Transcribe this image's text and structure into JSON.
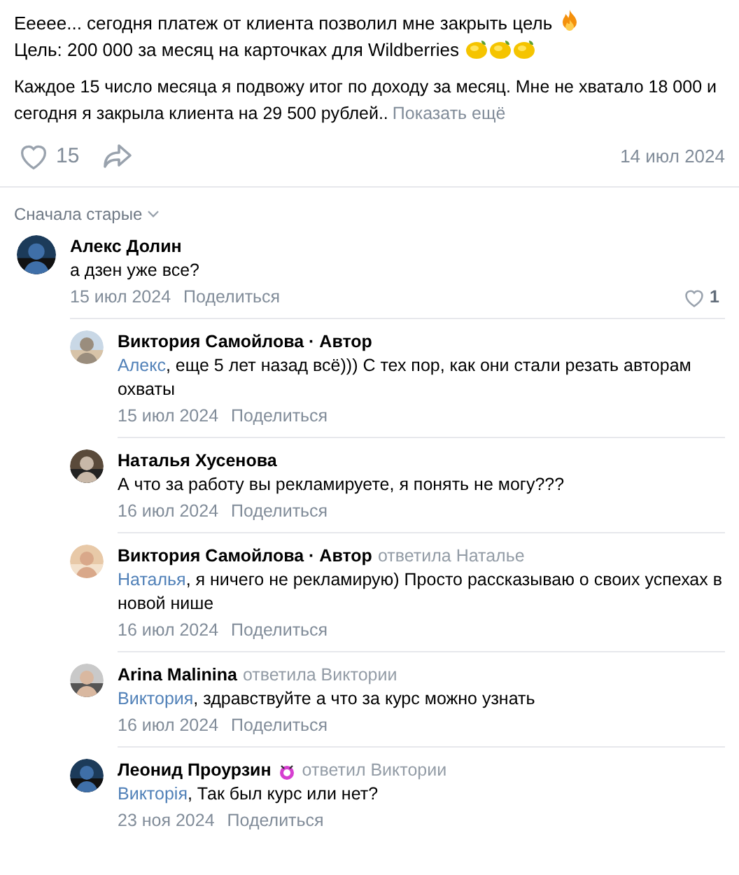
{
  "post": {
    "lines": [
      "Еееее... сегодня платеж от клиента позволил мне закрыть цель",
      "Цель: 200 000 за месяц на карточках для Wildberries"
    ],
    "body": "Каждое 15 число месяца я подвожу итог по доходу за месяц. Мне не хватало 18 000 и сегодня я закрыла клиента на 29 500 рублей..",
    "more": "Показать ещё",
    "likes": "15",
    "date": "14 июл 2024"
  },
  "sort": "Сначала старые",
  "comments": [
    {
      "name": "Алекс Долин",
      "text": "а дзен уже все?",
      "date": "15 июл 2024",
      "share": "Поделиться",
      "likes": "1",
      "replies": [
        {
          "name": "Виктория Самойлова · Автор",
          "mention": "Алекс",
          "text": ", еще 5 лет назад всё))) С тех пор, как они стали резать авторам охваты",
          "date": "15 июл 2024",
          "share": "Поделиться"
        },
        {
          "name": "Наталья Хусенова",
          "text": "А что за работу вы рекламируете, я понять не могу???",
          "date": "16 июл 2024",
          "share": "Поделиться"
        },
        {
          "name": "Виктория Самойлова · Автор",
          "reply_to": "ответила Наталье",
          "mention": "Наталья",
          "text": ", я ничего не рекламирую) Просто рассказываю о своих успехах в новой нише",
          "date": "16 июл 2024",
          "share": "Поделиться"
        },
        {
          "name": "Arina Malinina",
          "reply_to": "ответила Виктории",
          "mention": "Виктория",
          "text": ", здравствуйте а что за курс можно узнать",
          "date": "16 июл 2024",
          "share": "Поделиться"
        },
        {
          "name": "Леонид Проурзин",
          "badge": true,
          "reply_to": "ответил Виктории",
          "mention": "Викторія",
          "text": ", Так был курс или нет?",
          "date": "23 ноя 2024",
          "share": "Поделиться"
        }
      ]
    }
  ]
}
